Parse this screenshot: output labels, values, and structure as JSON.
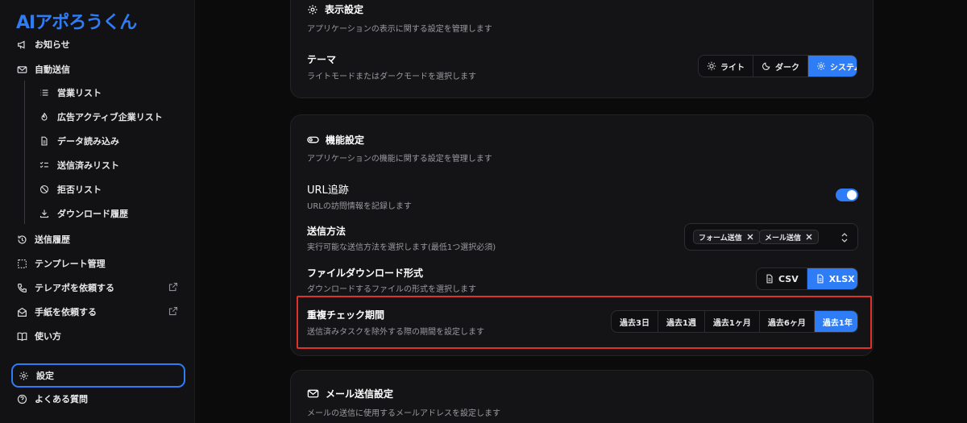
{
  "app": {
    "logo": "AIアポろうくん"
  },
  "sidebar": {
    "items": [
      {
        "label": "お知らせ",
        "icon": "megaphone-icon"
      },
      {
        "label": "自動送信",
        "icon": "mail-icon"
      },
      {
        "label": "営業リスト",
        "icon": "list-icon"
      },
      {
        "label": "広告アクティブ企業リスト",
        "icon": "flame-icon"
      },
      {
        "label": "データ読み込み",
        "icon": "file-icon"
      },
      {
        "label": "送信済みリスト",
        "icon": "checklist-icon"
      },
      {
        "label": "拒否リスト",
        "icon": "ban-icon"
      },
      {
        "label": "ダウンロード履歴",
        "icon": "download-icon"
      },
      {
        "label": "送信履歴",
        "icon": "history-icon"
      },
      {
        "label": "テンプレート管理",
        "icon": "template-icon"
      },
      {
        "label": "テレアポを依頼する",
        "icon": "phone-icon"
      },
      {
        "label": "手紙を依頼する",
        "icon": "letter-icon"
      },
      {
        "label": "使い方",
        "icon": "book-icon"
      },
      {
        "label": "設定",
        "icon": "gear-icon"
      },
      {
        "label": "よくある質問",
        "icon": "help-icon"
      }
    ]
  },
  "display_settings": {
    "title": "表示設定",
    "description": "アプリケーションの表示に関する設定を管理します",
    "theme": {
      "label": "テーマ",
      "description": "ライトモードまたはダークモードを選択します",
      "options": [
        "ライト",
        "ダーク",
        "システム"
      ],
      "selected": "システム"
    }
  },
  "feature_settings": {
    "title": "機能設定",
    "description": "アプリケーションの機能に関する設定を管理します",
    "url_tracking": {
      "label": "URL追跡",
      "description": "URLの訪問情報を記録します",
      "enabled": true
    },
    "send_method": {
      "label": "送信方法",
      "description": "実行可能な送信方法を選択します(最低1つ選択必須)",
      "chips": [
        "フォーム送信",
        "メール送信"
      ]
    },
    "file_format": {
      "label": "ファイルダウンロード形式",
      "description": "ダウンロードするファイルの形式を選択します",
      "options": [
        "CSV",
        "XLSX"
      ],
      "selected": "XLSX"
    },
    "duplicate_check": {
      "label": "重複チェック期間",
      "description": "送信済みタスクを除外する際の期間を設定します",
      "options": [
        "過去3日",
        "過去1週",
        "過去1ヶ月",
        "過去6ヶ月",
        "過去1年"
      ],
      "selected": "過去1年"
    }
  },
  "mail_settings": {
    "title": "メール送信設定",
    "description": "メールの送信に使用するメールアドレスを設定します"
  },
  "colors": {
    "accent": "#2f7df6",
    "highlight": "#e0322a",
    "background": "#0b0b0c"
  }
}
